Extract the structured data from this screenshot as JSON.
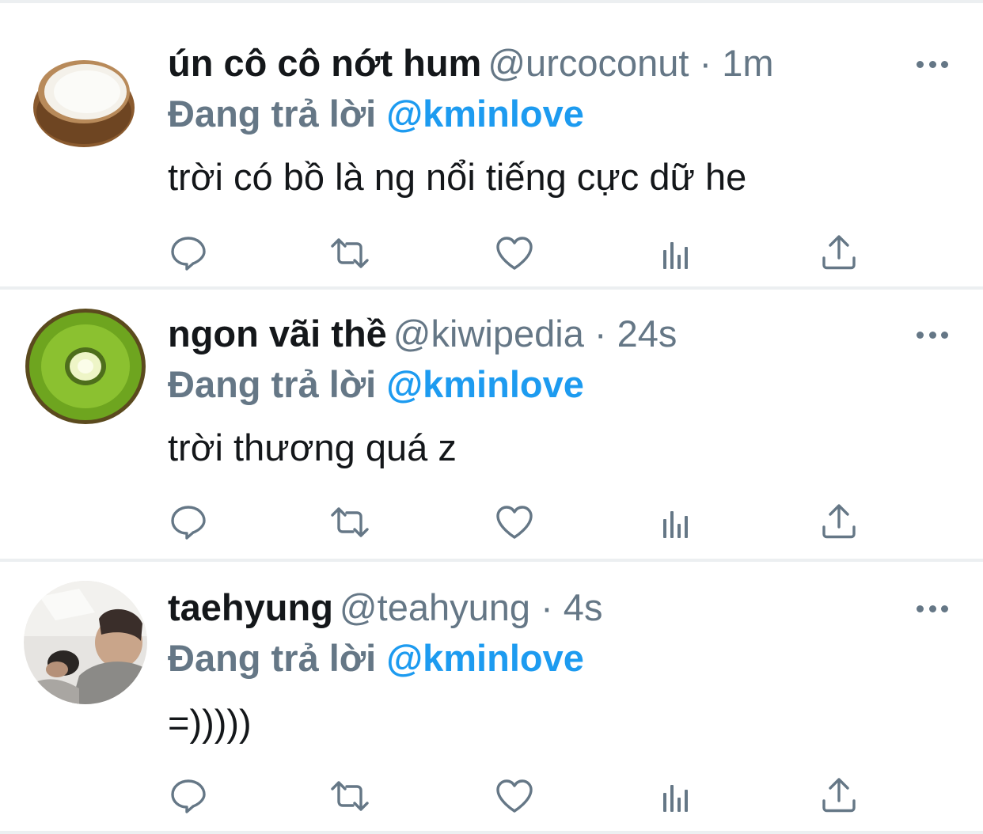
{
  "colors": {
    "text": "#14171a",
    "muted": "#657786",
    "accent": "#1d9bf0",
    "divider": "#eceff1"
  },
  "tweets": [
    {
      "avatar": "coconut-avatar",
      "name": "ún cô cô nớt hum",
      "handle": "@urcoconut",
      "time": "· 1m",
      "reply_prefix": "Đang trả lời",
      "reply_to": "@kminlove",
      "text": "trời có bồ là ng nổi tiếng cực dữ he"
    },
    {
      "avatar": "kiwi-avatar",
      "name": "ngon vãi thề",
      "handle": "@kiwipedia",
      "time": "· 24s",
      "reply_prefix": "Đang trả lời",
      "reply_to": "@kminlove",
      "text": "trời thương quá z"
    },
    {
      "avatar": "photo-avatar",
      "name": "taehyung",
      "handle": "@teahyung",
      "time": "· 4s",
      "reply_prefix": "Đang trả lời",
      "reply_to": "@kminlove",
      "text": "=)))))"
    }
  ],
  "actions": [
    "reply-icon",
    "retweet-icon",
    "like-icon",
    "analytics-icon",
    "share-icon"
  ]
}
